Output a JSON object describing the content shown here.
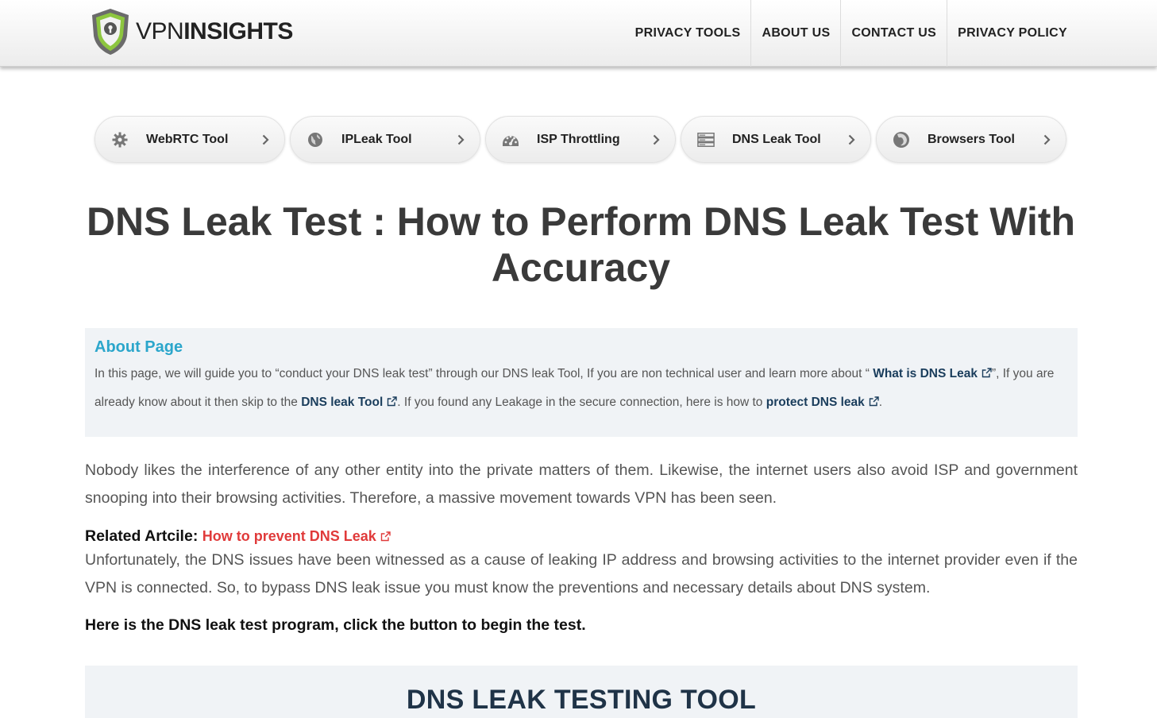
{
  "header": {
    "logo": {
      "prefix": "VPN",
      "suffix": "INSIGHTS"
    },
    "nav": [
      {
        "label": "PRIVACY TOOLS"
      },
      {
        "label": "ABOUT US"
      },
      {
        "label": "CONTACT US"
      },
      {
        "label": "PRIVACY POLICY"
      }
    ]
  },
  "tools": [
    {
      "label": "WebRTC Tool",
      "icon": "gear-icon"
    },
    {
      "label": "IPLeak Tool",
      "icon": "globe-icon"
    },
    {
      "label": "ISP Throttling",
      "icon": "speedometer-icon"
    },
    {
      "label": "DNS Leak Tool",
      "icon": "server-icon"
    },
    {
      "label": "Browsers Tool",
      "icon": "firefox-icon"
    }
  ],
  "title": "DNS Leak Test : How to Perform DNS Leak Test With Accuracy",
  "about": {
    "heading": "About Page",
    "text1": "In this page, we will guide you to “conduct your DNS leak test” through our DNS leak Tool, If you are non technical user and learn more about “ ",
    "link1": "What is DNS Leak",
    "text2": "”, If you are already know about it then skip to the ",
    "link2": "DNS leak Tool",
    "text3": ". If you found any Leakage in the secure connection, here is how to ",
    "link3": "protect DNS leak",
    "text4": "."
  },
  "body": {
    "p1": "Nobody likes the interference of any other entity into the private matters of them. Likewise, the internet users also avoid ISP and government snooping into their browsing activities. Therefore, a massive movement towards VPN has been seen.",
    "related_label": "Related Artcile:",
    "related_link": "How to prevent DNS Leak",
    "p2": "Unfortunately, the DNS issues have been witnessed as a cause of leaking IP address and browsing activities to the internet provider even if the VPN is connected. So, to bypass DNS leak issue you must know the preventions and necessary details about DNS system.",
    "cta": "Here is the DNS leak test program, click the button to begin the test."
  },
  "toolbox": {
    "title": "DNS LEAK TESTING TOOL"
  },
  "colors": {
    "accent": "#2ba6cb",
    "link": "#1a3d5c",
    "related_link": "#e03a3a",
    "box_bg": "#f0f3f6"
  }
}
